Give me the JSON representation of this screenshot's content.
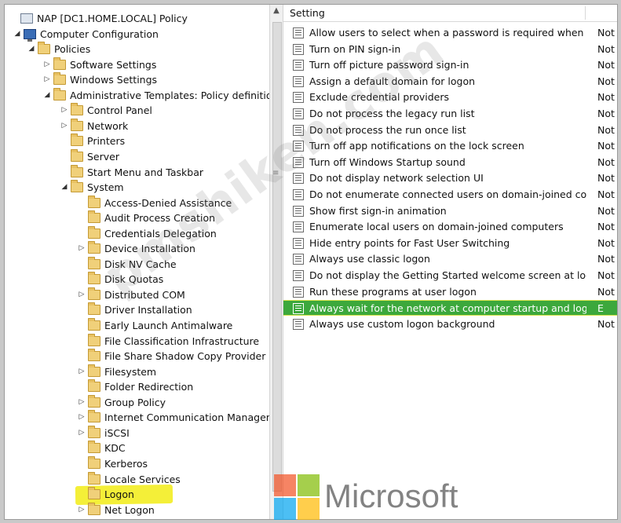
{
  "tree": {
    "root_label": "NAP [DC1.HOME.LOCAL] Policy",
    "items": [
      {
        "label": "NAP [DC1.HOME.LOCAL] Policy",
        "level": 0,
        "icon": "policy-icon",
        "expander": ""
      },
      {
        "label": "Computer Configuration",
        "level": 1,
        "icon": "computer-icon",
        "expander": "◢"
      },
      {
        "label": "Policies",
        "level": 2,
        "icon": "folder-icon",
        "expander": "◢"
      },
      {
        "label": "Software Settings",
        "level": 3,
        "icon": "folder-icon",
        "expander": "▷"
      },
      {
        "label": "Windows Settings",
        "level": 3,
        "icon": "folder-icon",
        "expander": "▷"
      },
      {
        "label": "Administrative Templates: Policy definitions",
        "level": 3,
        "icon": "folder-icon",
        "expander": "◢"
      },
      {
        "label": "Control Panel",
        "level": 4,
        "icon": "folder-icon",
        "expander": "▷"
      },
      {
        "label": "Network",
        "level": 4,
        "icon": "folder-icon",
        "expander": "▷"
      },
      {
        "label": "Printers",
        "level": 4,
        "icon": "folder-icon",
        "expander": ""
      },
      {
        "label": "Server",
        "level": 4,
        "icon": "folder-icon",
        "expander": ""
      },
      {
        "label": "Start Menu and Taskbar",
        "level": 4,
        "icon": "folder-icon",
        "expander": ""
      },
      {
        "label": "System",
        "level": 4,
        "icon": "folder-icon",
        "expander": "◢"
      },
      {
        "label": "Access-Denied Assistance",
        "level": 5,
        "icon": "folder-icon",
        "expander": ""
      },
      {
        "label": "Audit Process Creation",
        "level": 5,
        "icon": "folder-icon",
        "expander": ""
      },
      {
        "label": "Credentials Delegation",
        "level": 5,
        "icon": "folder-icon",
        "expander": ""
      },
      {
        "label": "Device Installation",
        "level": 5,
        "icon": "folder-icon",
        "expander": "▷"
      },
      {
        "label": "Disk NV Cache",
        "level": 5,
        "icon": "folder-icon",
        "expander": ""
      },
      {
        "label": "Disk Quotas",
        "level": 5,
        "icon": "folder-icon",
        "expander": ""
      },
      {
        "label": "Distributed COM",
        "level": 5,
        "icon": "folder-icon",
        "expander": "▷"
      },
      {
        "label": "Driver Installation",
        "level": 5,
        "icon": "folder-icon",
        "expander": ""
      },
      {
        "label": "Early Launch Antimalware",
        "level": 5,
        "icon": "folder-icon",
        "expander": ""
      },
      {
        "label": "File Classification Infrastructure",
        "level": 5,
        "icon": "folder-icon",
        "expander": ""
      },
      {
        "label": "File Share Shadow Copy Provider",
        "level": 5,
        "icon": "folder-icon",
        "expander": ""
      },
      {
        "label": "Filesystem",
        "level": 5,
        "icon": "folder-icon",
        "expander": "▷"
      },
      {
        "label": "Folder Redirection",
        "level": 5,
        "icon": "folder-icon",
        "expander": ""
      },
      {
        "label": "Group Policy",
        "level": 5,
        "icon": "folder-icon",
        "expander": "▷"
      },
      {
        "label": "Internet Communication Management",
        "level": 5,
        "icon": "folder-icon",
        "expander": "▷"
      },
      {
        "label": "iSCSI",
        "level": 5,
        "icon": "folder-icon",
        "expander": "▷"
      },
      {
        "label": "KDC",
        "level": 5,
        "icon": "folder-icon",
        "expander": ""
      },
      {
        "label": "Kerberos",
        "level": 5,
        "icon": "folder-icon",
        "expander": ""
      },
      {
        "label": "Locale Services",
        "level": 5,
        "icon": "folder-icon",
        "expander": ""
      },
      {
        "label": "Logon",
        "level": 5,
        "icon": "folder-icon",
        "expander": "",
        "highlighted": true
      },
      {
        "label": "Net Logon",
        "level": 5,
        "icon": "folder-icon",
        "expander": "▷"
      }
    ]
  },
  "list": {
    "column_setting": "Setting",
    "rows": [
      {
        "setting": "Allow users to select when a password is required when resu...",
        "state": "Not c"
      },
      {
        "setting": "Turn on PIN sign-in",
        "state": "Not c"
      },
      {
        "setting": "Turn off picture password sign-in",
        "state": "Not c"
      },
      {
        "setting": "Assign a default domain for logon",
        "state": "Not c"
      },
      {
        "setting": "Exclude credential providers",
        "state": "Not c"
      },
      {
        "setting": "Do not process the legacy run list",
        "state": "Not c"
      },
      {
        "setting": "Do not process the run once list",
        "state": "Not c"
      },
      {
        "setting": "Turn off app notifications on the lock screen",
        "state": "Not c"
      },
      {
        "setting": "Turn off Windows Startup sound",
        "state": "Not c"
      },
      {
        "setting": "Do not display network selection UI",
        "state": "Not c"
      },
      {
        "setting": "Do not enumerate connected users on domain-joined com...",
        "state": "Not c"
      },
      {
        "setting": "Show first sign-in animation",
        "state": "Not c"
      },
      {
        "setting": "Enumerate local users on domain-joined computers",
        "state": "Not c"
      },
      {
        "setting": "Hide entry points for Fast User Switching",
        "state": "Not c"
      },
      {
        "setting": "Always use classic logon",
        "state": "Not c"
      },
      {
        "setting": "Do not display the Getting Started welcome screen at logon",
        "state": "Not c"
      },
      {
        "setting": "Run these programs at user logon",
        "state": "Not c"
      },
      {
        "setting": "Always wait for the network at computer startup and logon",
        "state": "E",
        "selected": true
      },
      {
        "setting": "Always use custom logon background",
        "state": "Not c"
      }
    ]
  },
  "watermark": {
    "text": "pmshiken.com",
    "brand": "Microsoft"
  },
  "colors": {
    "selection_green": "#3ca83c",
    "highlight_yellow": "#f4ef38",
    "folder": "#f0d07a",
    "ms_red": "#f25022",
    "ms_green": "#7fba00",
    "ms_blue": "#00a4ef",
    "ms_yellow": "#ffb900"
  }
}
